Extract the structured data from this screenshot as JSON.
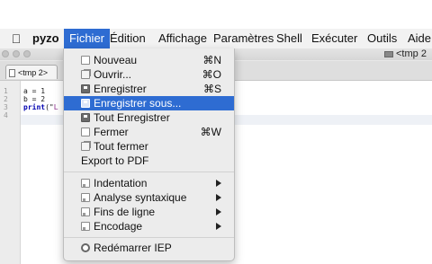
{
  "menubar": {
    "apple_icon": "apple-icon",
    "app_name": "pyzo",
    "items": [
      "Fichier",
      "Édition",
      "Affichage",
      "Paramètres",
      "Shell",
      "Exécuter",
      "Outils",
      "Aide"
    ],
    "active": "Fichier",
    "active_color": "#2e6cd2"
  },
  "window": {
    "title": "<tmp 2",
    "tab_label": "<tmp 2>"
  },
  "editor": {
    "line_numbers": [
      "1",
      "2",
      "3",
      "4"
    ],
    "code_a": "a = 1",
    "code_b": "b = 2",
    "code_print_kw": "print",
    "code_print_rest": "(\"",
    "code_print_str": "L"
  },
  "fichier_menu": {
    "items": {
      "nouveau": {
        "label": "Nouveau",
        "shortcut": "⌘N",
        "icon": "new-file-icon"
      },
      "ouvrir": {
        "label": "Ouvrir...",
        "shortcut": "⌘O",
        "icon": "open-folder-icon"
      },
      "enregistrer": {
        "label": "Enregistrer",
        "shortcut": "⌘S",
        "icon": "save-icon"
      },
      "enregistrer_sous": {
        "label": "Enregistrer sous...",
        "icon": "save-as-icon",
        "highlighted": true
      },
      "tout_enregistrer": {
        "label": "Tout Enregistrer",
        "icon": "save-all-icon"
      },
      "fermer": {
        "label": "Fermer",
        "shortcut": "⌘W",
        "icon": "close-file-icon"
      },
      "tout_fermer": {
        "label": "Tout fermer",
        "icon": "close-all-icon"
      },
      "export_pdf": {
        "label": "Export to PDF"
      },
      "indentation": {
        "label": "Indentation",
        "icon": "indent-icon",
        "submenu": true
      },
      "analyse": {
        "label": "Analyse syntaxique",
        "icon": "syntax-icon",
        "submenu": true
      },
      "fins_ligne": {
        "label": "Fins de ligne",
        "icon": "line-endings-icon",
        "submenu": true
      },
      "encodage": {
        "label": "Encodage",
        "icon": "encoding-icon",
        "submenu": true
      },
      "redemarrer": {
        "label": "Redémarrer IEP",
        "icon": "restart-icon"
      }
    }
  }
}
